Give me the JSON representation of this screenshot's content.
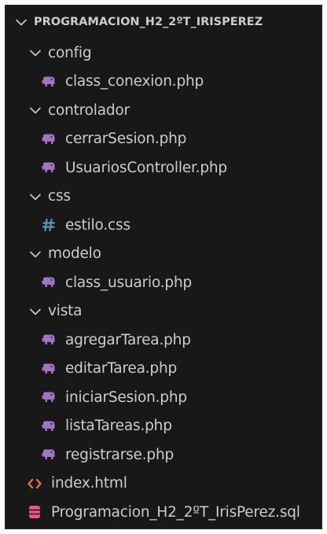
{
  "explorer": {
    "root_label": "PROGRAMACION_H2_2ºT_IRISPEREZ",
    "items": [
      {
        "kind": "folder",
        "label": "config"
      },
      {
        "kind": "file",
        "icon": "php-elephant-icon",
        "label": "class_conexion.php"
      },
      {
        "kind": "folder",
        "label": "controlador"
      },
      {
        "kind": "file",
        "icon": "php-elephant-icon",
        "label": "cerrarSesion.php"
      },
      {
        "kind": "file",
        "icon": "php-elephant-icon",
        "label": "UsuariosController.php"
      },
      {
        "kind": "folder",
        "label": "css"
      },
      {
        "kind": "file",
        "icon": "css-hash-icon",
        "label": "estilo.css"
      },
      {
        "kind": "folder",
        "label": "modelo"
      },
      {
        "kind": "file",
        "icon": "php-elephant-icon",
        "label": "class_usuario.php"
      },
      {
        "kind": "folder",
        "label": "vista"
      },
      {
        "kind": "file",
        "icon": "php-elephant-icon",
        "label": "agregarTarea.php"
      },
      {
        "kind": "file",
        "icon": "php-elephant-icon",
        "label": "editarTarea.php"
      },
      {
        "kind": "file",
        "icon": "php-elephant-icon",
        "label": "iniciarSesion.php"
      },
      {
        "kind": "file",
        "icon": "php-elephant-icon",
        "label": "listaTareas.php"
      },
      {
        "kind": "file",
        "icon": "php-elephant-icon",
        "label": "registrarse.php"
      },
      {
        "kind": "file",
        "icon": "html-code-icon",
        "label": "index.html"
      },
      {
        "kind": "file",
        "icon": "database-icon",
        "label": "Programacion_H2_2ºT_IrisPerez.sql"
      }
    ]
  },
  "colors": {
    "background": "#181818",
    "text": "#cccccc",
    "php_icon": "#a074c4",
    "css_icon": "#519aba",
    "html_icon": "#e37933",
    "sql_icon": "#f55385"
  }
}
